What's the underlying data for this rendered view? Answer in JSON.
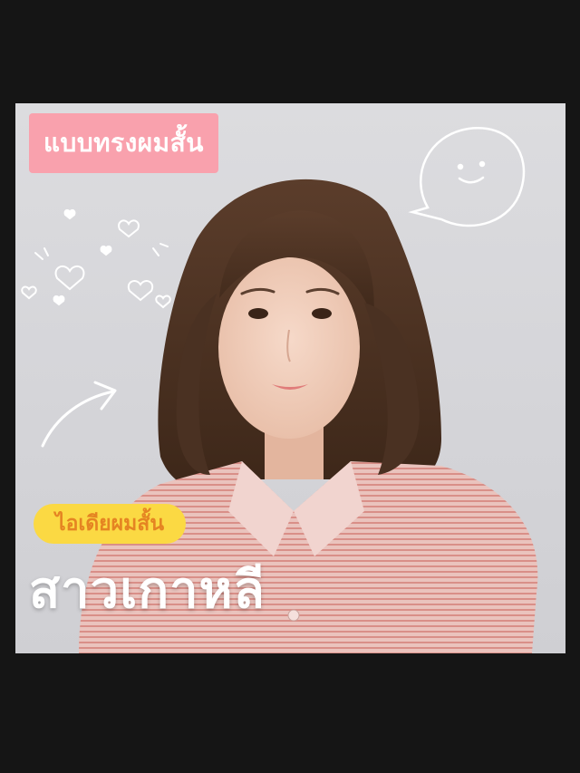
{
  "labels": {
    "top_pill": "แบบทรงผมสั้น",
    "subtitle_pill": "ไอเดียผมสั้น",
    "main_title": "สาวเกาหลี"
  },
  "colors": {
    "page_background": "#151515",
    "top_pill": "#f9a1ad",
    "subtitle_pill": "#fbd943",
    "subtitle_text": "#e58422",
    "title_text": "#ffffff"
  },
  "icons": [
    "speech-bubble-smiley-icon",
    "hearts-doodle-icon",
    "arrow-doodle-icon"
  ]
}
